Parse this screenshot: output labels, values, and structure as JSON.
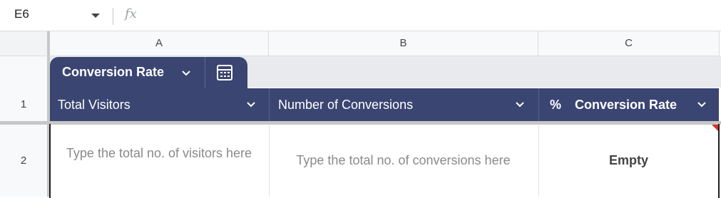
{
  "formula_bar": {
    "cell_ref": "E6",
    "fx_label": "fx",
    "formula": ""
  },
  "columns": [
    "A",
    "B",
    "C"
  ],
  "rows": [
    "1",
    "2"
  ],
  "table": {
    "name": "Conversion Rate",
    "header_color": "#3b4572",
    "headers": [
      {
        "type_icon": "",
        "label": "Total Visitors"
      },
      {
        "type_icon": "",
        "label": "Number of Conversions"
      },
      {
        "type_icon": "%",
        "label": "Conversion Rate"
      }
    ],
    "row2": {
      "a_placeholder": "Type the total no. of visitors here",
      "b_placeholder": "Type the total no. of conversions here",
      "c_value": "Empty"
    }
  },
  "icons": {
    "namebox_dropdown": "triangle-down-icon",
    "chevron": "chevron-down-icon",
    "calc": "table-calculator-icon",
    "note": "comment-indicator-icon"
  }
}
